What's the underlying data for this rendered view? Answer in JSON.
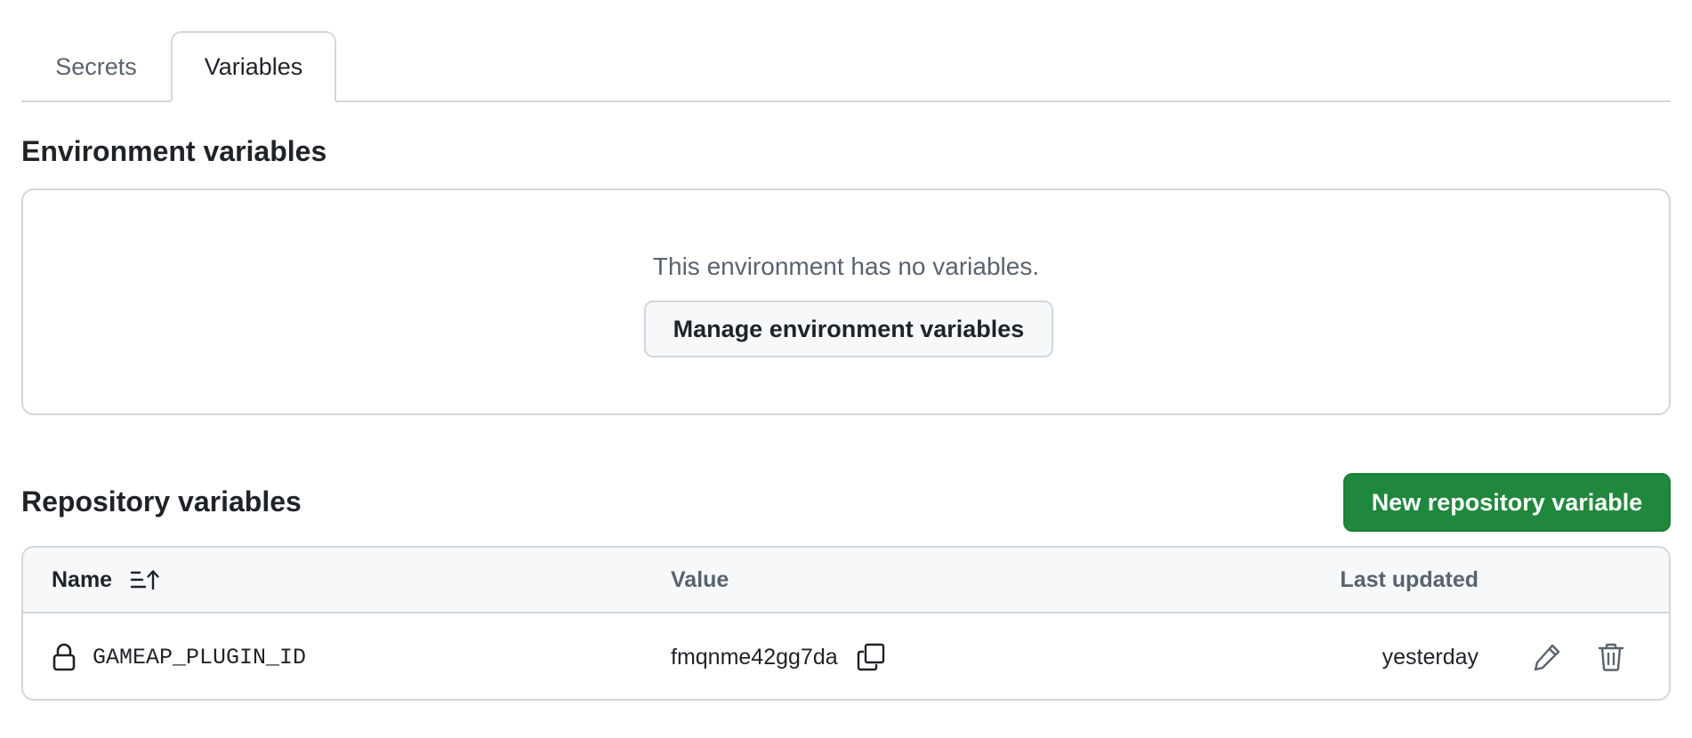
{
  "tabs": [
    {
      "label": "Secrets",
      "active": false
    },
    {
      "label": "Variables",
      "active": true
    }
  ],
  "environment": {
    "title": "Environment variables",
    "empty_message": "This environment has no variables.",
    "manage_button_label": "Manage environment variables"
  },
  "repository": {
    "title": "Repository variables",
    "new_button_label": "New repository variable",
    "table": {
      "columns": {
        "name": "Name",
        "value": "Value",
        "last_updated": "Last updated"
      },
      "rows": [
        {
          "name": "GAMEAP_PLUGIN_ID",
          "value": "fmqnme42gg7da",
          "last_updated": "yesterday"
        }
      ]
    }
  },
  "icons": {
    "sort": "sort-ascending-icon",
    "lock": "lock-icon",
    "copy": "copy-icon",
    "edit": "pencil-icon",
    "delete": "trash-icon"
  },
  "colors": {
    "primary_button": "#1f883d",
    "border": "#d0d7de",
    "muted_text": "#59636e",
    "text": "#1f2328",
    "header_bg": "#f6f8fa"
  }
}
